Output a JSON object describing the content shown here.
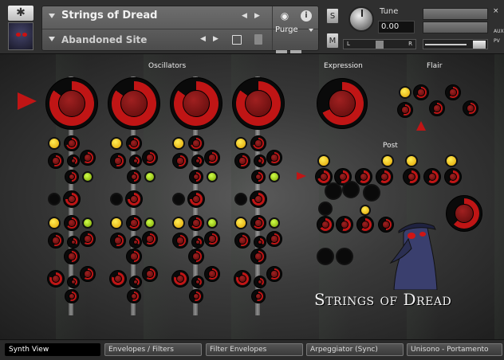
{
  "header": {
    "instrument_name": "Strings of Dread",
    "snapshot_name": "Abandoned Site",
    "purge_label": "Purge",
    "s_label": "S",
    "m_label": "M",
    "tune_label": "Tune",
    "tune_value": "0.00",
    "pan_left": "L",
    "pan_right": "R",
    "aux_label": "AUX",
    "pv_label": "PV",
    "close_label": "×",
    "gear_icon": "gear-icon",
    "camera_icon": "camera-icon",
    "info_icon": "info-icon",
    "info_glyph": "i"
  },
  "sections": {
    "oscillators": "Oscillators",
    "expression": "Expression",
    "flair": "Flair",
    "post": "Post"
  },
  "title_art": "Strings of Dread",
  "tabs": [
    {
      "label": "Synth View",
      "active": true
    },
    {
      "label": "Envelopes / Filters",
      "active": false
    },
    {
      "label": "Filter Envelopes",
      "active": false
    },
    {
      "label": "Arpeggiator (Sync)",
      "active": false
    },
    {
      "label": "Unisono - Portamento",
      "active": false
    }
  ],
  "colors": {
    "accent_red": "#c01515",
    "knob_dark": "#0a0a0a",
    "yellow": "#ffd000",
    "green": "#a4d600"
  }
}
